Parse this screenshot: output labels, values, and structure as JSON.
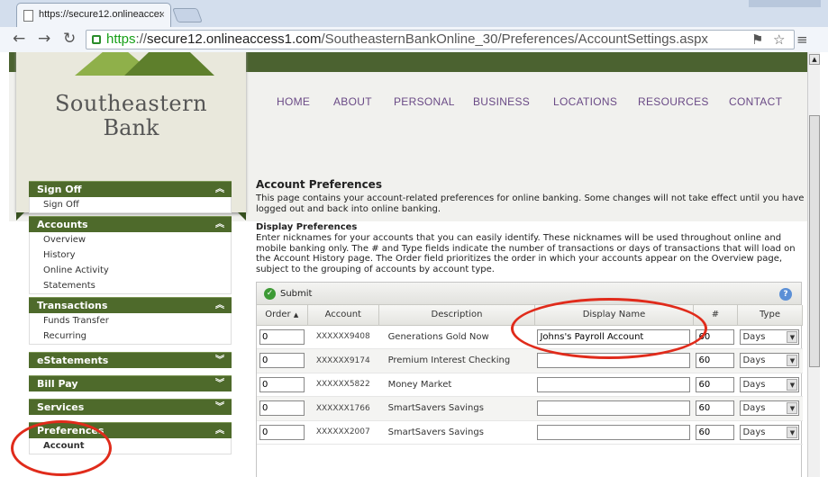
{
  "browser": {
    "tab_title": "https://secure12.onlineacce:",
    "tab_close": "×",
    "url_scheme": "https",
    "url_sep": "://",
    "url_domain": "secure12.onlineaccess1.com",
    "url_path": "/SoutheasternBankOnline_30/Preferences/AccountSettings.aspx"
  },
  "bank": {
    "name_line1": "Southeastern",
    "name_line2": "Bank"
  },
  "nav": [
    "HOME",
    "ABOUT",
    "PERSONAL",
    "BUSINESS",
    "LOCATIONS",
    "RESOURCES",
    "CONTACT"
  ],
  "sidebar": {
    "sections": [
      {
        "title": "Sign Off",
        "expanded": true,
        "items": [
          "Sign Off"
        ]
      },
      {
        "title": "Accounts",
        "expanded": true,
        "items": [
          "Overview",
          "History",
          "Online Activity",
          "Statements"
        ]
      },
      {
        "title": "Transactions",
        "expanded": true,
        "items": [
          "Funds Transfer",
          "Recurring"
        ]
      },
      {
        "title": "eStatements",
        "expanded": false,
        "items": []
      },
      {
        "title": "Bill Pay",
        "expanded": false,
        "items": []
      },
      {
        "title": "Services",
        "expanded": false,
        "items": []
      },
      {
        "title": "Preferences",
        "expanded": true,
        "items": [
          "Account"
        ]
      }
    ]
  },
  "content": {
    "title": "Account Preferences",
    "intro": "This page contains your account-related preferences for online banking. Some changes will not take effect until you have logged out and back into online banking.",
    "display_title": "Display Preferences",
    "display_text": "Enter nicknames for your accounts that you can easily identify. These nicknames will be used throughout online and mobile banking only. The # and Type fields indicate the number of transactions or days of transactions that will load on the Account History page. The Order field prioritizes the order in which your accounts appear on the Overview page, subject to the grouping of accounts by account type.",
    "submit_label": "Submit",
    "help": "?"
  },
  "grid": {
    "columns": [
      "Order",
      "Account",
      "Description",
      "Display Name",
      "#",
      "Type"
    ],
    "rows": [
      {
        "order": "0",
        "account": "XXXXXX9408",
        "description": "Generations Gold Now",
        "display_name": "Johns's Payroll Account",
        "count": "60",
        "type": "Days"
      },
      {
        "order": "0",
        "account": "XXXXXX9174",
        "description": "Premium Interest Checking",
        "display_name": "",
        "count": "60",
        "type": "Days"
      },
      {
        "order": "0",
        "account": "XXXXXX5822",
        "description": "Money Market",
        "display_name": "",
        "count": "60",
        "type": "Days"
      },
      {
        "order": "0",
        "account": "XXXXXX1766",
        "description": "SmartSavers Savings",
        "display_name": "",
        "count": "60",
        "type": "Days"
      },
      {
        "order": "0",
        "account": "XXXXXX2007",
        "description": "SmartSavers Savings",
        "display_name": "",
        "count": "60",
        "type": "Days"
      }
    ]
  },
  "colors": {
    "sidebar_header": "#4e6a2b",
    "nav_text": "#6a4a86",
    "annotation": "#e02b1b"
  }
}
